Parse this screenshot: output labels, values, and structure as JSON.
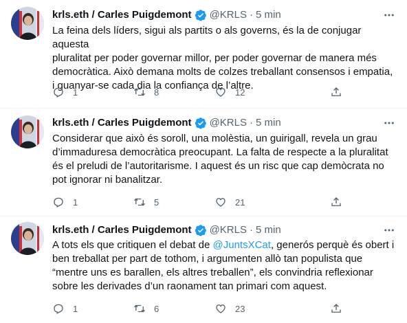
{
  "tweets": [
    {
      "name": "krls.eth / Carles Puigdemont",
      "handle": "@KRLS",
      "dot": "·",
      "time": "5 min",
      "text": "La feina dels líders, sigui als partits o als governs, és la de conjugar aquesta\npluralitat per poder governar millor, per poder governar de manera més\ndemocràtica. Això demana molts de colzes treballant consensos i empatia,\ni guanyar-se cada dia la confiança de l’altre.",
      "replies": "1",
      "retweets": "8",
      "likes": "12"
    },
    {
      "name": "krls.eth / Carles Puigdemont",
      "handle": "@KRLS",
      "dot": "·",
      "time": "5 min",
      "text": "Considerar que això és soroll, una molèstia, un guirigall, revela un grau\nd’immaduresa democràtica preocupant. La falta de respecte a la pluralitat\nés el preludi de l’autoritarisme. I aquest és un risc que cap demòcrata no\npot ignorar ni banalitzar.",
      "replies": "1",
      "retweets": "5",
      "likes": "21"
    },
    {
      "name": "krls.eth / Carles Puigdemont",
      "handle": "@KRLS",
      "dot": "·",
      "time": "5 min",
      "text_before": "A tots els que critiquen el debat de ",
      "mention": "@JuntsXCat",
      "text_after": ", generós perquè és obert i\nben treballat per part de tothom, i argumenten allò tan populista que\n“mentre uns es barallen, els altres treballen”, els convindria reflexionar\nsobre les derivades d’un raonament tan primari com aquest.",
      "replies": "1",
      "retweets": "6",
      "likes": "23"
    }
  ],
  "colors": {
    "text": "#0f1419",
    "secondary": "#536471",
    "accent": "#1d9bf0",
    "divider": "#eff3f4"
  },
  "icons": {
    "verified": "verified-badge-icon",
    "more": "more-icon",
    "reply": "reply-icon",
    "retweet": "retweet-icon",
    "like": "heart-icon",
    "share": "share-icon"
  }
}
